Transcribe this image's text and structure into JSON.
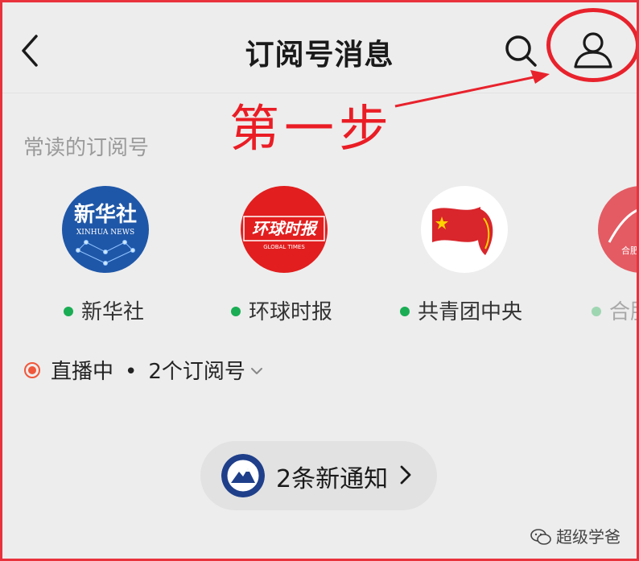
{
  "header": {
    "title": "订阅号消息",
    "back_icon": "chevron-left-icon",
    "search_icon": "search-icon",
    "profile_icon": "user-icon"
  },
  "annotation": {
    "step_text": "第一步",
    "color": "#e8222c"
  },
  "section": {
    "frequent_label": "常读的订阅号"
  },
  "accounts": [
    {
      "name": "新华社",
      "logo_text": "新华社",
      "logo_subtext": "XINHUA NEWS",
      "color": "#1f57a8"
    },
    {
      "name": "环球时报",
      "logo_text": "环球时报",
      "logo_subtext": "GLOBAL TIMES",
      "color": "#e21e1e"
    },
    {
      "name": "共青团中央",
      "color": "#d8262c"
    },
    {
      "name": "合肥",
      "logo_text": "合肥",
      "color": "#e45b63"
    }
  ],
  "live": {
    "status": "直播中",
    "separator": "•",
    "count_text": "2个订阅号"
  },
  "notification": {
    "text": "2条新通知"
  },
  "watermark": {
    "text": "超级学爸"
  },
  "colors": {
    "background": "#ededed",
    "live_red": "#f0573b",
    "online_green": "#1aad54"
  }
}
